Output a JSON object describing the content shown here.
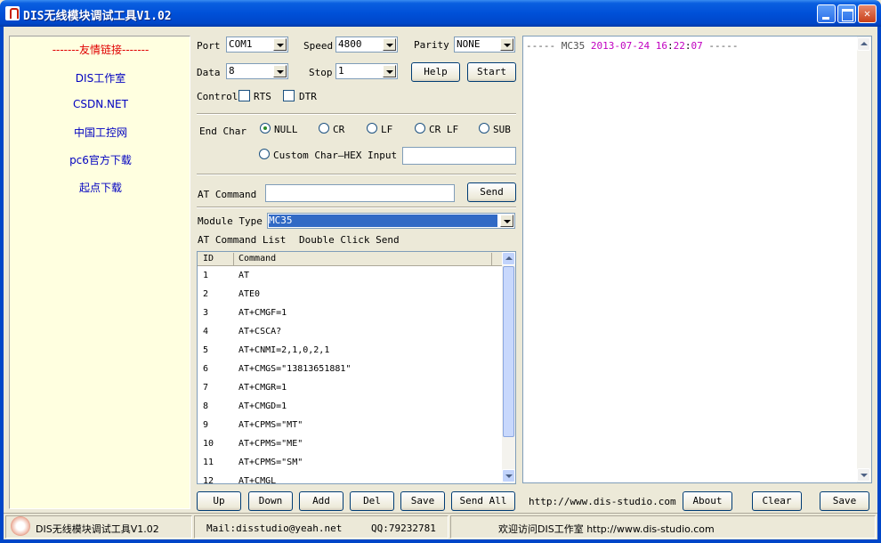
{
  "window": {
    "title": "DIS无线模块调试工具V1.02"
  },
  "links": {
    "title": "-------友情链接-------",
    "items": [
      "DIS工作室",
      "CSDN.NET",
      "中国工控网",
      "pc6官方下载",
      "起点下载"
    ]
  },
  "serial": {
    "port_label": "Port",
    "port_value": "COM1",
    "speed_label": "Speed",
    "speed_value": "4800",
    "parity_label": "Parity",
    "parity_value": "NONE",
    "data_label": "Data",
    "data_value": "8",
    "stop_label": "Stop",
    "stop_value": "1",
    "help_label": "Help",
    "start_label": "Start",
    "control_label": "Control",
    "rts_label": "RTS",
    "dtr_label": "DTR"
  },
  "endchar": {
    "label": "End Char",
    "options": [
      "NULL",
      "CR",
      "LF",
      "CR LF",
      "SUB"
    ],
    "selected": "NULL",
    "custom_label": "Custom Char—HEX Input",
    "custom_value": ""
  },
  "at": {
    "label": "AT Command",
    "value": "",
    "send_label": "Send",
    "module_label": "Module Type",
    "module_value": "MC35",
    "list_label": "AT Command List",
    "list_hint": "Double Click Send"
  },
  "command_list": {
    "headers": [
      "ID",
      "Command"
    ],
    "rows": [
      {
        "id": "1",
        "command": "AT"
      },
      {
        "id": "2",
        "command": "ATE0"
      },
      {
        "id": "3",
        "command": "AT+CMGF=1"
      },
      {
        "id": "4",
        "command": "AT+CSCA?"
      },
      {
        "id": "5",
        "command": "AT+CNMI=2,1,0,2,1"
      },
      {
        "id": "6",
        "command": "AT+CMGS=\"13813651881\""
      },
      {
        "id": "7",
        "command": "AT+CMGR=1"
      },
      {
        "id": "8",
        "command": "AT+CMGD=1"
      },
      {
        "id": "9",
        "command": "AT+CPMS=\"MT\""
      },
      {
        "id": "10",
        "command": "AT+CPMS=\"ME\""
      },
      {
        "id": "11",
        "command": "AT+CPMS=\"SM\""
      },
      {
        "id": "12",
        "command": "AT+CMGL"
      }
    ]
  },
  "bottom_buttons": {
    "up": "Up",
    "down": "Down",
    "add": "Add",
    "del": "Del",
    "save": "Save",
    "send_all": "Send All",
    "url": "http://www.dis-studio.com",
    "about": "About",
    "clear": "Clear",
    "save2": "Save"
  },
  "output": {
    "dash_left": "----- ",
    "module": "MC35 ",
    "date": "2013-07-24",
    "time_h": "16",
    "colon1": ":",
    "time_m": "22",
    "colon2": ":",
    "time_s": "07",
    "dash_right": " -----"
  },
  "status": {
    "app": "DIS无线模块调试工具V1.02",
    "mail": "Mail:disstudio@yeah.net",
    "qq": "QQ:79232781",
    "welcome": "欢迎访问DIS工作室 http://www.dis-studio.com"
  },
  "colors": {
    "titlebar": "#0050d8",
    "links_bg": "#ffffe0",
    "links_title": "#e00000",
    "link_text": "#0000c0",
    "highlight": "#c000c0"
  }
}
